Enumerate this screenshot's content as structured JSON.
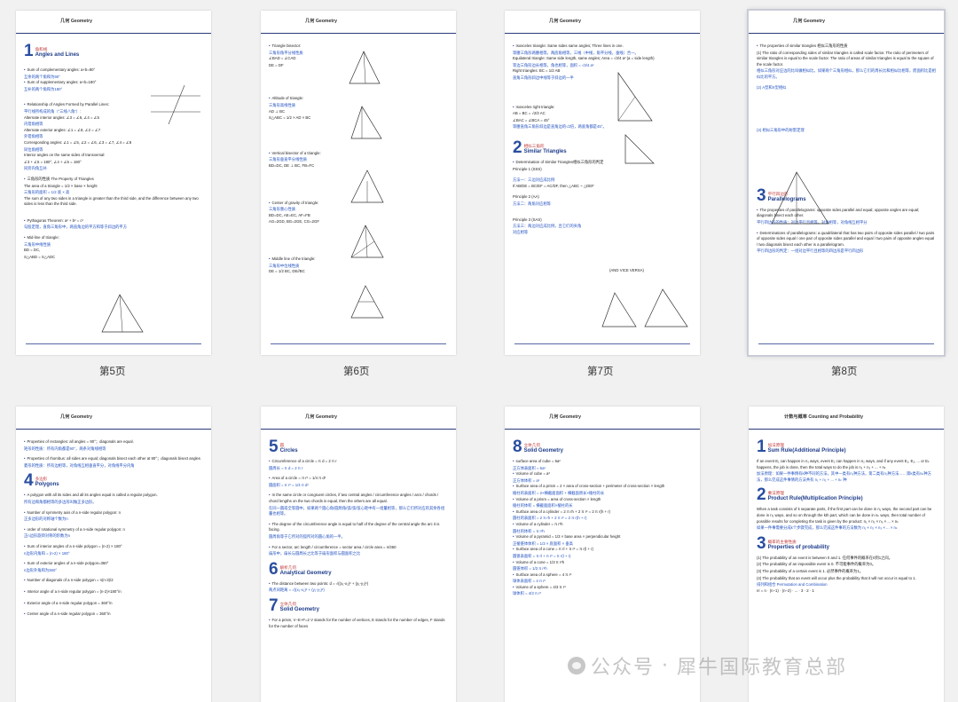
{
  "pages": {
    "p5": {
      "header": "几何 Geometry",
      "caption": "第5页",
      "section": {
        "num": "1",
        "zh": "角和线",
        "en": "Angles and Lines"
      },
      "items": [
        "Sum of complementary angles:  a+b=90°",
        "互余的两个角和为90°",
        "Sum of supplementary angles:  a+b=180°",
        "互补的两个角和为180°",
        "Relationship of Angles Formed by Parallel Lines:",
        "平行线所构成的角（“三线八角”）:",
        "Alternate interior angles: ∠3 = ∠6, ∠4 = ∠5",
        "内错角相等",
        "Alternate exterior angles: ∠1 = ∠8, ∠2 = ∠7",
        "外错角相等",
        "Corresponding angles: ∠1 = ∠5, ∠2 = ∠6, ∠3 = ∠7, ∠4 = ∠8",
        "同位角相等",
        "Interior angles on the same sides of transversal:",
        "∠3 + ∠5 = 180°, ∠4 + ∠6 = 180°",
        "同旁内角互补",
        "三角形的性质 The Property of Triangles",
        "The area of a triangle = 1/2 × base × height",
        "三角形的面积 = 1/2 底 × 高",
        "The sum of any two sides in a triangle is greater than the third side, and the difference between any two sides is less than the third side.",
        "Pythagoras Theorem:  a² + b² = c²",
        "勾股定理，直角三角形中，两直角边的平方和等于斜边的平方",
        "Mid-line of triangle:",
        "三角形中线性质",
        "BD = DC,",
        "S△ABD = S△ADC"
      ]
    },
    "p6": {
      "header": "几何 Geometry",
      "caption": "第6页",
      "items": [
        "Triangle bisector:",
        "三角形角平分线性质",
        "∠BAD = ∠CAD",
        "DE = DF",
        "Altitude of triangle:",
        "三角形高线性质",
        "AD ⊥ BC",
        "S△ABC = 1/2 × AD × BC",
        "Vertical bisector of a triangle:",
        "三角形垂直平分线性质",
        "BD=DC, DE ⊥ BC, FB=FC",
        "Center of gravity of triangle:",
        "三角形重心性质",
        "BD=DC, AE=EC, AF=FB",
        "AG=2GD, BG=2GE, CG=2GF",
        "Middle line of the triangle:",
        "三角形中位线性质",
        "DE = 1/2 BC, DE//BC"
      ]
    },
    "p7": {
      "header": "几何 Geometry",
      "caption": "第7页",
      "items": [
        "Isosceles triangle: Same sides same angles; Three lines in one.",
        "等腰三角形两腰相等，两底角相等，三线（中线，角平分线，垂线）合一。",
        "Equilateral triangle: Same side length, same angles;  Area = √3/4 a² (a = side length)",
        "等边三角形边长相等，角也相等，面积 = √3/4 a²",
        "Right triangles: BC = 1/2 AB",
        "直角三角形斜边中线等于斜边的一半",
        "Isosceles right triangle:",
        "AB = BC = √2/2 AC",
        "∠BAC = ∠BCA = 45°",
        "等腰直角三角形斜边是直角边的√2倍，两底角都是45°。",
        "Determination of Similar Triangles相似三角形的判定",
        "Principle 1 (SSS)",
        "方法一：三边对应成比例",
        "If AB/DE = BC/EF = AC/DF, then △ABC ~ △DEF",
        "Principle 2 (AA)",
        "方法二：两角对应相等",
        "Principle 3 (SAS)",
        "方法三：两边对应成比例，且它们的夹角对应相等",
        "(AND VICE VERSA)"
      ],
      "section": {
        "num": "2",
        "zh": "相似三角形",
        "en": "Similar Triangles"
      }
    },
    "p8": {
      "header": "几何 Geometry",
      "caption": "第8页",
      "items": [
        "The properties of similar triangles 相似三角形的性质",
        "(1) The ratio of corresponding sides of similar triangles is called scale factor. The ratio of perimeters of similar triangles is equal to the scale factor. The ratio of areas of similar triangles is equal to the square of the scale factor.",
        "相似三角形对应边的比叫做相似比。如果两个三角形相似，那么它们的周长比和相似比相等，而面积比是相似比的平方。",
        "(2) A型和X型相似",
        "(3) 相似三角形中的射影定理",
        "The properties of parallelograms: opposite sides parallel and equal; opposite angles are equal; diagonals bisect each other.",
        "平行四边形的性质：对边平行且相等，对角相等，对角线互相平分",
        "Determinations of parallelograms: a quadrilateral that has two pairs of opposite sides parallel / two pairs of opposite sides equal / one pair of opposite sides parallel and equal / two pairs of opposite angles equal / two diagonals bisect each other is a parallelogram.",
        "平行四边形的判定：一组对边平行且相等的四边形是平行四边形"
      ],
      "section": {
        "num": "3",
        "zh": "平行四边形",
        "en": "Parallelograms"
      }
    },
    "p9": {
      "header": "几何 Geometry",
      "items": [
        "Properties of rectangles: all angles = 90°；diagonals are equal.",
        "矩形的性质：所有内角都是90°，两条对角线相等",
        "Properties of rhombus: all sides are equal; diagonals bisect each other at 90°；diagonals bisect angles",
        "菱形的性质：所有边相等，对角线互相垂直平分，对角线平分内角",
        "A polygon with all its sides and all its angles equal is called a regular polygon.",
        "所有边和角都相等的多边形叫做正多边形。",
        "Number of symmetry axis of a n-side regular polygon: n",
        "正多边形的对称轴个数为n",
        "order of rotational symmetry of a n-side regular polygon: n",
        "正n边形旋转对称的阶数为n",
        "Sum of interior angles of a n-side polygon = (n-2) × 180°",
        "n边形内角和 = (n-2) × 180°",
        "Sum of exterior angles of a n-side polygon=360°",
        "n边形外角和为360°",
        "Number of diagonals of a n-side polygon = n(n-3)/2",
        "Interior angle of a n-side regular polygon = (n-2)×180°/n",
        "Exterior angle of a n-side regular polygon = 360°/n",
        "Center angle of a n-side regular polygon = 360°/n"
      ],
      "section": {
        "num": "4",
        "zh": "多边形",
        "en": "Polygons"
      }
    },
    "p10": {
      "header": "几何 Geometry",
      "sections": [
        {
          "num": "5",
          "zh": "圆",
          "en": "Circles"
        },
        {
          "num": "6",
          "zh": "解析几何",
          "en": "Analytical Geometry"
        },
        {
          "num": "7",
          "zh": "立体几何",
          "en": "Solid Geometry"
        }
      ],
      "items": [
        "Circumference of a circle = π d = 2 π r",
        "圆周长 = π d = 2 π r",
        "Area of a circle = π r² = 1/4 π d²",
        "圆面积 = π r² = 1/4 π d²",
        "In the same circle or congruent circles, if two central angles / circumference angles / arcs / chords / chord lengths on the two chords is equal, then the others are all equal.",
        "在同一圆或全等圆中，如果两个圆心角/圆周角/弧/弦/弦心距中有一组量相等，那么它们所对应的其余各组量也相等。",
        "The degree of the circumference angle is equal to half of the degree of the central angle the arc it is facing.",
        "圆周角等于它所对的弧所对的圆心角的一半。",
        "For a sector, arc length / circumference = sector area / circle area = n/360",
        "扇形中，扇长与圆周长之比等于扇形面积与圆面积之比",
        "The distance between two points:  d = √((x₁-x₂)² + (y₁-y₂)²)",
        "两点间距离 = √((x₁-x₂)² + (y₁-y₂)²)",
        "For a prism, V−E+F=2  V stands for the number of vertices, E stands for the number of edges, F stands for the number of faces"
      ]
    },
    "p11": {
      "header": "几何 Geometry",
      "section": {
        "num": "8",
        "zh": "立体几何",
        "en": "Solid Geometry"
      },
      "items": [
        "surface area of cube = 6a²",
        "正方体表面积 = 6a²",
        "Volume of cube = a³",
        "正方体体积 = a³",
        "Surface area of a prism = 2 × area of cross-section + perimeter of cross-section × length",
        "棱柱的表面积 = 2×横截面面积 + 横截面周长×棱柱的长",
        "Volume of a prism = area of cross-section × length",
        "棱柱的体积 = 横截面面积×棱柱的长",
        "Surface area of a cylinder = 2 π rh + 2 π r² = 2 π r(h + r)",
        "圆柱的表面积 = 2 π rh + 2 π r² = 2 π r(h + r)",
        "Volume of a cylinder = π r²h",
        "圆柱的体积 = π r²h",
        "Volume of a pyramid = 1/3 × base area × perpendicular height",
        "正棱锥体体积 = 1/3 × 底面积 × 垂高",
        "Surface area of a cone = π rl + π r² = π r(l + r)",
        "圆锥表面积 = π rl + π r² = π r(l + r)",
        "Volume of a cone = 1/3 π r²h",
        "圆锥体积 = 1/3 π r²h",
        "Surface area of a sphere = 4 π r²",
        "球体表面积 = 4 π r²",
        "Volume of a sphere = 4/3 π r³",
        "球体积 = 4/3 π r³"
      ]
    },
    "p12": {
      "header": "计数与概率 Counting and Probability",
      "sections": [
        {
          "num": "1",
          "zh": "加法原理",
          "en": "Sum Rule(Additional Principle)"
        },
        {
          "num": "2",
          "zh": "乘法原理",
          "en": "Product Rule(Multiplication Principle)"
        },
        {
          "num": "3",
          "zh": "概率的主要性质",
          "en": "Properties of probability"
        }
      ],
      "items": [
        "If an event E₁ can happen in n₁ ways, event E₂ can happen in n₂ ways, and if any event E₁, E₂, ... or Eₖ happens, the job is done, then the total ways to do the job is n₁ + n₂ + ... + nₖ",
        "加法原理：如果一件事情有k种不同的方法，其中一类有n₁种方法，第二类有n₂种方法……第k类有nₖ种方法，那么完成这件事情的方法共有 n₁ + n₂ + ... + nₖ 种",
        "When a task consists of k separate parts, if the first part can be done in n₁ ways, the second part can be done in n₂ ways, and so on through the kth part, which can be done in nₖ ways, then total number of possible results for completing the task is given by the product: n₁ × n₂ × n₃ × ... × nₖ",
        "如果一件事需要分成k个步骤完成，那么完成这件事的方法数为 n₁ × n₂ × n₃ × ... × nₖ",
        "(1) The probability of an event is between 0 and 1. 任何事件的概率在0到1之间。",
        "(2) The probability of an impossible event is 0. 不可能事件的概率为0。",
        "(3) The probability of a certain event is 1. 必然事件的概率为1。",
        "(4) The probability that an event will occur plus the probability that it will not occur is equal to 1.",
        "排列和组合 Permutation and Combination",
        "n! = n · (n−1) · (n−2) · ... · 3 · 2 · 1"
      ]
    }
  },
  "watermark": {
    "prefix": "公众号",
    "separator": "·",
    "name": "犀牛国际教育总部"
  }
}
